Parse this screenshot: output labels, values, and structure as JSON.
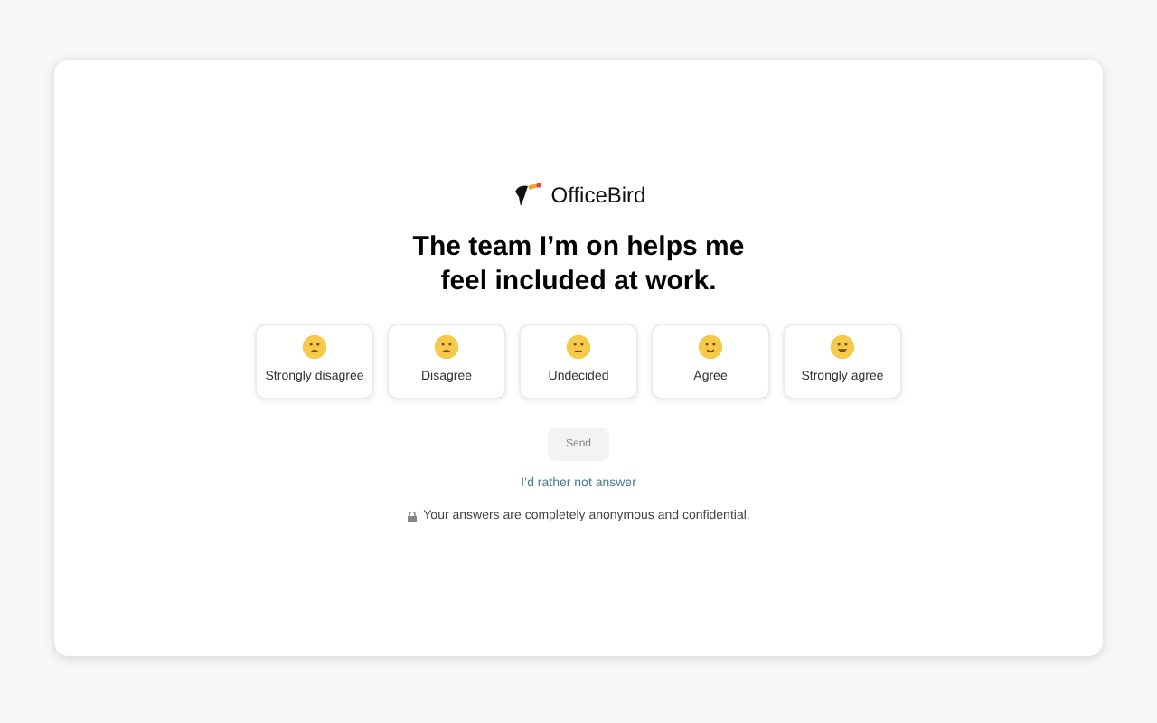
{
  "brand": {
    "name": "OfficeBird"
  },
  "question": "The team I’m on helps me feel included at work.",
  "options": [
    {
      "label": "Strongly disagree",
      "kind": "weary",
      "selected": false
    },
    {
      "label": "Disagree",
      "kind": "frown",
      "selected": false
    },
    {
      "label": "Undecided",
      "kind": "flat",
      "selected": false
    },
    {
      "label": "Agree",
      "kind": "smile",
      "selected": false
    },
    {
      "label": "Strongly agree",
      "kind": "grin",
      "selected": false
    }
  ],
  "submit": {
    "label": "Send",
    "disabled": true
  },
  "skip_link": "I’d rather not answer",
  "privacy_note": "Your answers are completely anonymous and confidential."
}
